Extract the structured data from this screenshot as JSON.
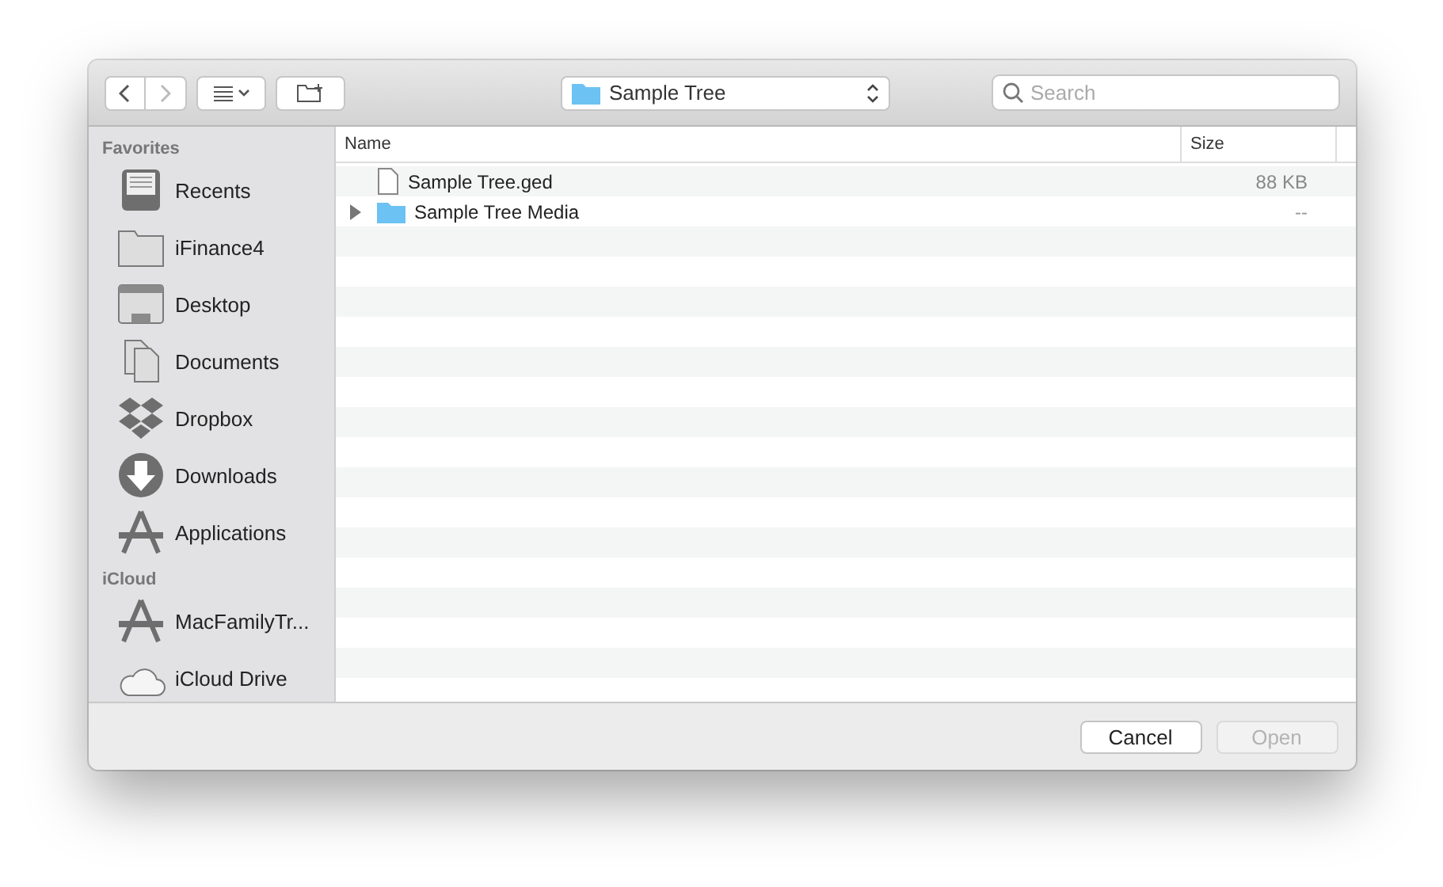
{
  "toolbar": {
    "location": "Sample Tree",
    "search": {
      "placeholder": "Search"
    }
  },
  "sidebar": {
    "sections": [
      {
        "title": "Favorites",
        "items": [
          {
            "label": "Recents",
            "kind": "recents"
          },
          {
            "label": "iFinance4",
            "kind": "folder"
          },
          {
            "label": "Desktop",
            "kind": "desktop"
          },
          {
            "label": "Documents",
            "kind": "documents"
          },
          {
            "label": "Dropbox",
            "kind": "dropbox"
          },
          {
            "label": "Downloads",
            "kind": "downloads"
          },
          {
            "label": "Applications",
            "kind": "applications"
          }
        ]
      },
      {
        "title": "iCloud",
        "items": [
          {
            "label": "MacFamilyTr...",
            "kind": "applications"
          },
          {
            "label": "iCloud Drive",
            "kind": "cloud"
          }
        ]
      }
    ]
  },
  "table": {
    "columns": [
      "Name",
      "Size"
    ],
    "rows": [
      {
        "name": "Sample Tree.ged",
        "size": "88 KB",
        "kind": "file"
      },
      {
        "name": "Sample Tree Media",
        "size": "--",
        "kind": "folder",
        "expanded": false
      }
    ]
  },
  "buttons": [
    {
      "label": "Cancel",
      "disabled": false
    },
    {
      "label": "Open",
      "disabled": true
    }
  ]
}
